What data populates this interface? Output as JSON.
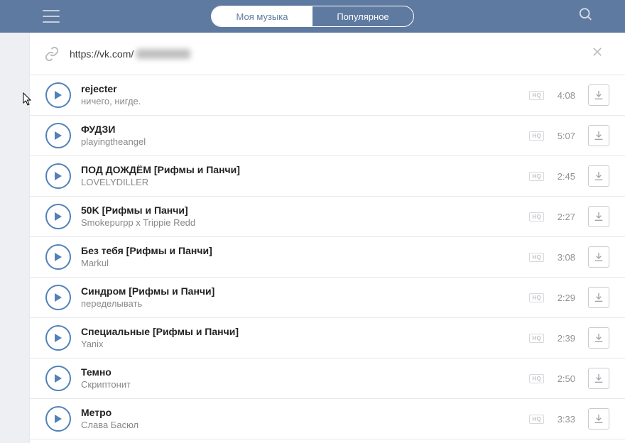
{
  "tabs": {
    "my": "Моя музыка",
    "popular": "Популярное"
  },
  "url": {
    "prefix": "https://vk.com/"
  },
  "hq_label": "HQ",
  "tracks": [
    {
      "title": "rejecter",
      "artist": "ничего, нигде.",
      "dur": "4:08"
    },
    {
      "title": "ФУДЗИ",
      "artist": "playingtheangel",
      "dur": "5:07"
    },
    {
      "title": "ПОД ДОЖДЁМ [Рифмы и Панчи]",
      "artist": "LOVELYDILLER",
      "dur": "2:45"
    },
    {
      "title": "50K [Рифмы и Панчи]",
      "artist": "Smokepurpp x Trippie Redd",
      "dur": "2:27"
    },
    {
      "title": "Без тебя [Рифмы и Панчи]",
      "artist": "Markul",
      "dur": "3:08"
    },
    {
      "title": "Синдром [Рифмы и Панчи]",
      "artist": "переделывать",
      "dur": "2:29"
    },
    {
      "title": "Специальные [Рифмы и Панчи]",
      "artist": "Yanix",
      "dur": "2:39"
    },
    {
      "title": "Темно",
      "artist": "Скриптонит",
      "dur": "2:50"
    },
    {
      "title": "Метро",
      "artist": "Слава Басюл",
      "dur": "3:33"
    }
  ]
}
